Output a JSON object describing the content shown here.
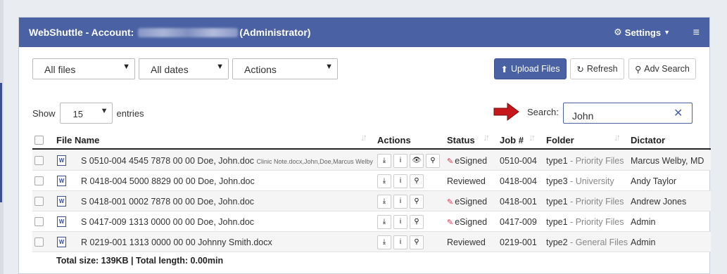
{
  "header": {
    "title": "WebShuttle - Account:",
    "role": "(Administrator)",
    "settings_label": "Settings"
  },
  "toolbar": {
    "files_filter": "All files",
    "dates_filter": "All dates",
    "actions_select": "Actions",
    "upload_label": "Upload Files",
    "refresh_label": "Refresh",
    "adv_search_label": "Adv Search"
  },
  "paging": {
    "show_label": "Show",
    "page_size": "15",
    "entries_label": "entries"
  },
  "search": {
    "label": "Search:",
    "value": "John"
  },
  "table": {
    "columns": [
      "File Name",
      "Actions",
      "Status",
      "Job #",
      "Folder",
      "Dictator"
    ],
    "rows": [
      {
        "file": "S 0510-004 4545 7878 00 00 Doe, John.doc",
        "note": "Clinic Note.docx,John,Doe,Marcus Welby",
        "status": "eSigned",
        "job": "0510-004",
        "folder_type": "type1",
        "folder_name": " - Priority Files",
        "dictator": "Marcus Welby, MD"
      },
      {
        "file": "R 0418-004 5000 8829 00 00 Doe, John.doc",
        "note": "",
        "status": "Reviewed",
        "job": "0418-004",
        "folder_type": "type3",
        "folder_name": " - University",
        "dictator": "Andy Taylor"
      },
      {
        "file": "S 0418-001 0002 7878 00 00 Doe, John.doc",
        "note": "",
        "status": "eSigned",
        "job": "0418-001",
        "folder_type": "type1",
        "folder_name": " - Priority Files",
        "dictator": "Andrew Jones"
      },
      {
        "file": "S 0417-009 1313 0000 00 00 Doe, John.doc",
        "note": "",
        "status": "eSigned",
        "job": "0417-009",
        "folder_type": "type1",
        "folder_name": " - Priority Files",
        "dictator": "Admin"
      },
      {
        "file": "R 0219-001 1313 0000 00 00 Johnny Smith.docx",
        "note": "",
        "status": "Reviewed",
        "job": "0219-001",
        "folder_type": "type2",
        "folder_name": " - General Files",
        "dictator": "Admin"
      }
    ]
  },
  "footer": {
    "summary": "Total size: 139KB | Total length: 0.00min"
  },
  "icons": {
    "doc_glyph": "W",
    "pencil": "✎",
    "download": "⤓",
    "info": "i",
    "view": "👁",
    "search": "⚲"
  }
}
